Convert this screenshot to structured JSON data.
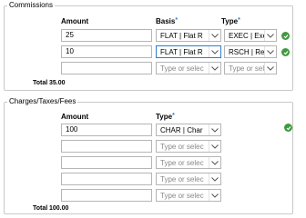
{
  "commissions": {
    "legend": "Commissions",
    "headers": {
      "amount": "Amount",
      "basis": "Basis",
      "type": "Type",
      "required_mark": "*"
    },
    "rows": [
      {
        "amount": "25",
        "basis": "FLAT | Flat R",
        "type": "EXEC | Exec"
      },
      {
        "amount": "10",
        "basis": "FLAT | Flat R",
        "type": "RSCH | Rese"
      },
      {
        "amount": "",
        "basis": "Type or selec",
        "type": "Type or selec"
      }
    ],
    "total_label": "Total",
    "total_value": "35.00"
  },
  "charges": {
    "legend": "Charges/Taxes/Fees",
    "headers": {
      "amount": "Amount",
      "type": "Type",
      "required_mark": "*"
    },
    "rows": [
      {
        "amount": "100",
        "type": "CHAR | Char"
      },
      {
        "amount": "",
        "type": "Type or selec"
      },
      {
        "amount": "",
        "type": "Type or selec"
      },
      {
        "amount": "",
        "type": "Type or selec"
      },
      {
        "amount": "",
        "type": "Type or selec"
      }
    ],
    "total_label": "Total",
    "total_value": "100.00"
  },
  "icons": {
    "valid": "check-circle-icon",
    "dropdown": "chevron-down-icon"
  },
  "colors": {
    "valid_green": "#3f9a3f",
    "required_blue": "#2e7bcf",
    "focus_blue": "#2e7bcf"
  }
}
